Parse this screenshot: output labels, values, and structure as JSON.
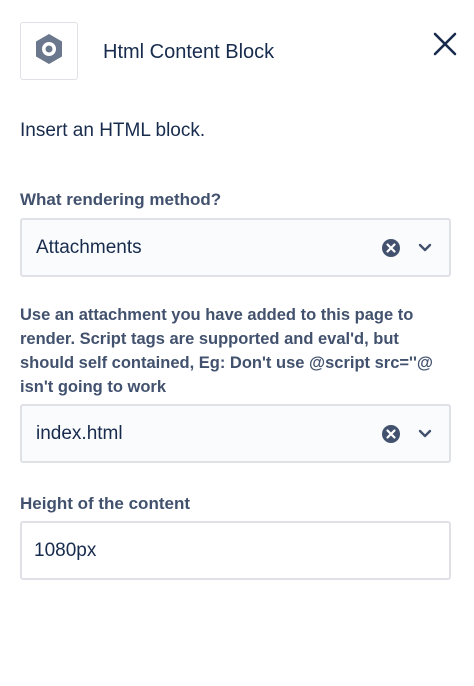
{
  "header": {
    "title": "Html Content Block",
    "logo_icon": "hexagon-gear-icon",
    "close_icon": "close-icon"
  },
  "intro_text": "Insert an HTML block.",
  "rendering_method": {
    "label": "What rendering method?",
    "value": "Attachments"
  },
  "help_text": "Use an attachment you have added to this page to render. Script tags are supported and eval'd, but should self contained, Eg: Don't use @script src=''@ isn't going to work",
  "attachment": {
    "value": "index.html"
  },
  "height": {
    "label": "Height of the content",
    "value": "1080px"
  },
  "colors": {
    "text_primary": "#172b4d",
    "text_secondary": "#42526e",
    "border": "#dfe1e6",
    "icon_gray": "#42526e"
  }
}
